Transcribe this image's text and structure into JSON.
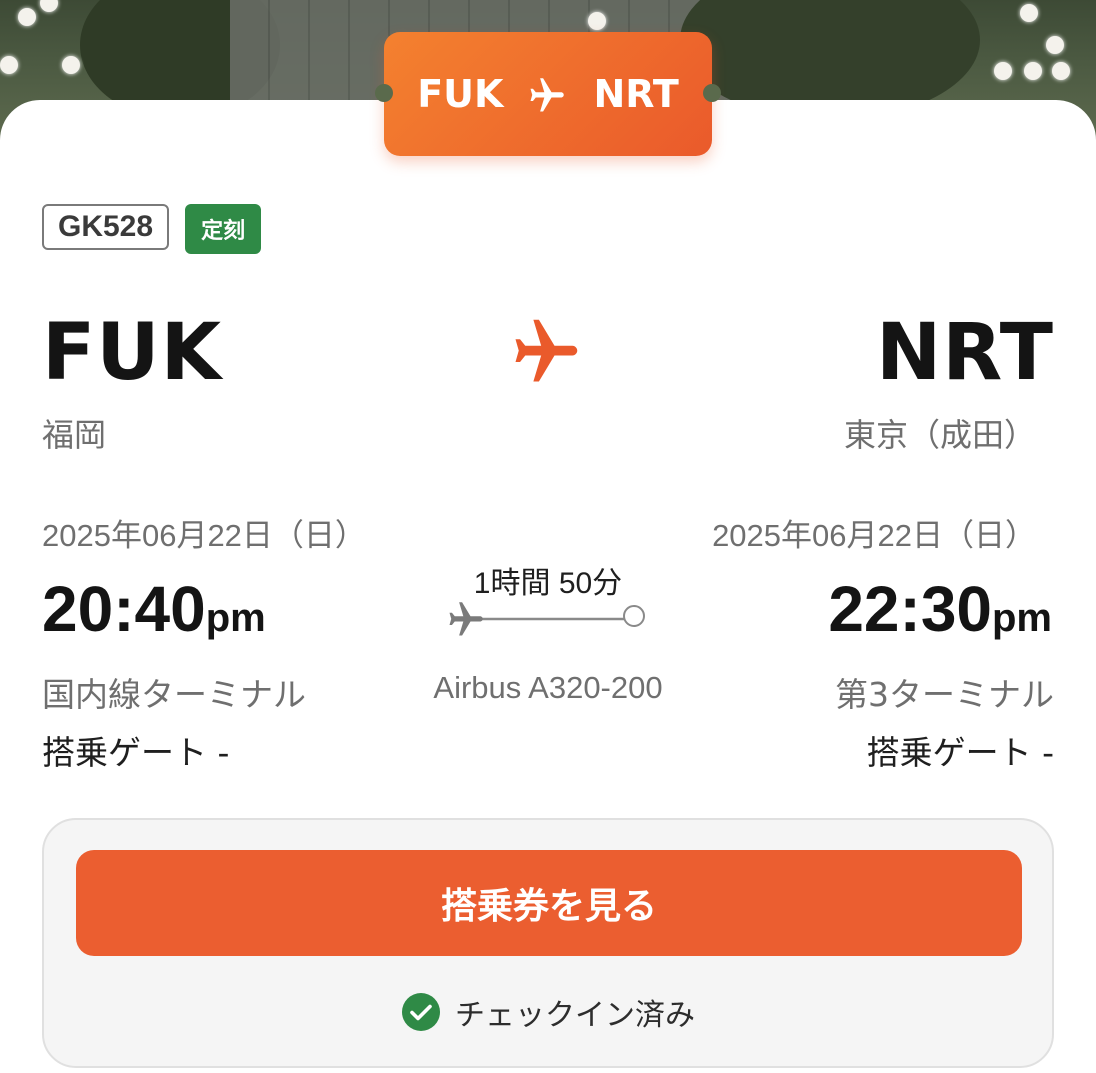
{
  "route_tab": {
    "origin": "FUK",
    "destination": "NRT",
    "plane_icon": "airplane-icon"
  },
  "flight": {
    "number": "GK528",
    "status": "定刻",
    "status_color": "#2f8a46"
  },
  "departure": {
    "code": "FUK",
    "city": "福岡",
    "date": "2025年06月22日（日）",
    "time": "20:40",
    "ampm": "pm",
    "terminal": "国内線ターミナル",
    "gate": "搭乗ゲート -"
  },
  "arrival": {
    "code": "NRT",
    "city": "東京（成田）",
    "date": "2025年06月22日（日）",
    "time": "22:30",
    "ampm": "pm",
    "terminal": "第3ターミナル",
    "gate": "搭乗ゲート -"
  },
  "duration": "1時間 50分",
  "aircraft": "Airbus A320-200",
  "actions": {
    "boarding_pass_label": "搭乗券を見る",
    "checkin_status": "チェックイン済み",
    "checkin_icon": "check-circle-icon"
  },
  "colors": {
    "accent": "#eb5e30",
    "success": "#2f8a46"
  }
}
